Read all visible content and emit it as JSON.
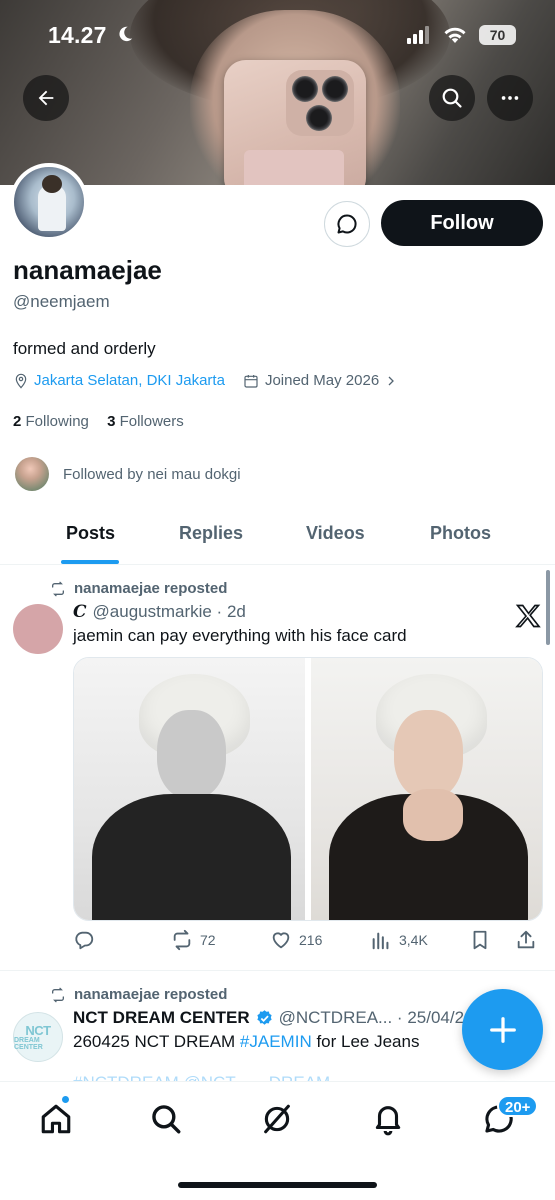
{
  "status_bar": {
    "time": "14.27",
    "battery": "70"
  },
  "profile": {
    "display_name": "nanamaejae",
    "handle": "@neemjaem",
    "bio": "formed and orderly",
    "location": "Jakarta Selatan, DKI Jakarta",
    "joined": "Joined May 2026",
    "following_count": "2",
    "following_label": "Following",
    "followers_count": "3",
    "followers_label": "Followers",
    "followed_by": "Followed by nei mau dokgi",
    "follow_label": "Follow"
  },
  "tabs": [
    {
      "label": "Posts",
      "active": true
    },
    {
      "label": "Replies",
      "active": false
    },
    {
      "label": "Videos",
      "active": false
    },
    {
      "label": "Photos",
      "active": false
    }
  ],
  "posts": [
    {
      "repost_label": "nanamaejae reposted",
      "author_mark": "C",
      "handle_date": "@augustmarkie · 2d",
      "text": "jaemin can pay everything with his face card",
      "actions": {
        "retweets": "72",
        "likes": "216",
        "views": "3,4K"
      }
    },
    {
      "repost_label": "nanamaejae reposted",
      "author_name": "NCT DREAM CENTER",
      "handle_date": "@NCTDREA... · 25/04/26",
      "text_prefix": "260425 NCT DREAM ",
      "hashtag": "#JAEMIN",
      "text_suffix": " for Lee Jeans",
      "faded_line": "#NCTDREAM @NCT_ ... DREAM",
      "avatar_text": "NCT",
      "avatar_sub": "DREAM CENTER"
    }
  ],
  "bottom_nav": {
    "messages_badge": "20+"
  },
  "colors": {
    "accent": "#1d9bf0",
    "text": "#0f1419",
    "secondary": "#536471"
  }
}
